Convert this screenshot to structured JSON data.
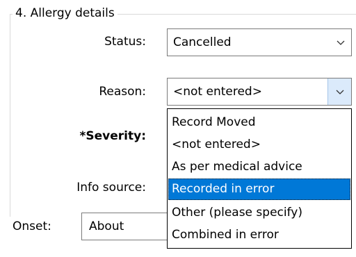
{
  "group": {
    "title": "4. Allergy details"
  },
  "fields": {
    "status": {
      "label": "Status:",
      "value": "Cancelled"
    },
    "reason": {
      "label": "Reason:",
      "value": "<not entered>",
      "options": [
        "Record Moved",
        "<not entered>",
        "As per medical advice",
        "Recorded in error",
        "Other (please specify)",
        "Combined in error"
      ],
      "highlighted_option": "Recorded in error"
    },
    "severity": {
      "label": "*Severity:"
    },
    "info_source": {
      "label": "Info source:"
    },
    "onset": {
      "label": "Onset:",
      "value": "About"
    }
  },
  "icons": {
    "dropdown_arrow": "chevron-down-icon"
  },
  "colors": {
    "selection_background": "#0078d7",
    "selection_text": "#ffffff",
    "open_button_background": "#dbeafb",
    "group_border": "#d9d9d9",
    "field_border": "#7a7a7a"
  }
}
